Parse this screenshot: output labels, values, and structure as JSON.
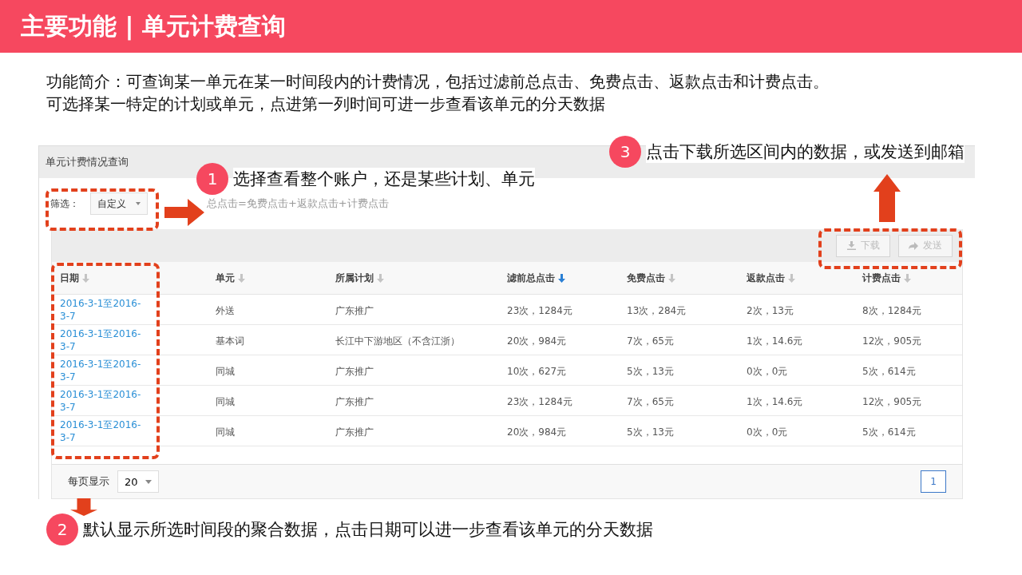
{
  "slide_title": "主要功能 | 单元计费查询",
  "intro": [
    "功能简介：可查询某一单元在某一时间段内的计费情况，包括过滤前总点击、免费点击、返款点击和计费点击。",
    "可选择某一特定的计划或单元，点进第一列时间可进一步查看该单元的分天数据"
  ],
  "panel": {
    "title": "单元计费情况查询",
    "filter": {
      "label": "筛选：",
      "value": "自定义"
    },
    "formula": "总点击=免费点击+返款点击+计费点击",
    "toolbar": [
      {
        "label": "下载",
        "kind": "download",
        "disabled": true
      },
      {
        "label": "发送",
        "kind": "send",
        "disabled": true
      }
    ],
    "columns": [
      {
        "label": "日期",
        "sort_active": false
      },
      {
        "label": "单元",
        "sort_active": false
      },
      {
        "label": "所属计划",
        "sort_active": false
      },
      {
        "label": "滤前总点击",
        "sort_active": true
      },
      {
        "label": "免费点击",
        "sort_active": false
      },
      {
        "label": "返款点击",
        "sort_active": false
      },
      {
        "label": "计费点击",
        "sort_active": false
      }
    ],
    "rows": [
      {
        "date": "2016-3-1至2016-3-7",
        "unit": "外送",
        "plan": "广东推广",
        "total": "23次，1284元",
        "free": "13次，284元",
        "refund": "2次，13元",
        "billed": "8次，1284元"
      },
      {
        "date": "2016-3-1至2016-3-7",
        "unit": "基本词",
        "plan": "长江中下游地区（不含江浙）",
        "total": "20次，984元",
        "free": "7次，65元",
        "refund": "1次，14.6元",
        "billed": "12次，905元"
      },
      {
        "date": "2016-3-1至2016-3-7",
        "unit": "同城",
        "plan": "广东推广",
        "total": "10次，627元",
        "free": "5次，13元",
        "refund": "0次，0元",
        "billed": "5次，614元"
      },
      {
        "date": "2016-3-1至2016-3-7",
        "unit": "同城",
        "plan": "广东推广",
        "total": "23次，1284元",
        "free": "7次，65元",
        "refund": "1次，14.6元",
        "billed": "12次，905元"
      },
      {
        "date": "2016-3-1至2016-3-7",
        "unit": "同城",
        "plan": "广东推广",
        "total": "20次，984元",
        "free": "5次，13元",
        "refund": "0次，0元",
        "billed": "5次，614元"
      }
    ],
    "footer": {
      "page_size_label": "每页显示",
      "page_size": "20",
      "pages": [
        {
          "label": "1",
          "selected": true
        }
      ]
    }
  },
  "annotations": [
    {
      "number": "1",
      "text": "选择查看整个账户，还是某些计划、单元"
    },
    {
      "number": "2",
      "text": "默认显示所选时间段的聚合数据，点击日期可以进一步查看该单元的分天数据"
    },
    {
      "number": "3",
      "text": "点击下载所选区间内的数据，或发送到邮箱"
    }
  ]
}
